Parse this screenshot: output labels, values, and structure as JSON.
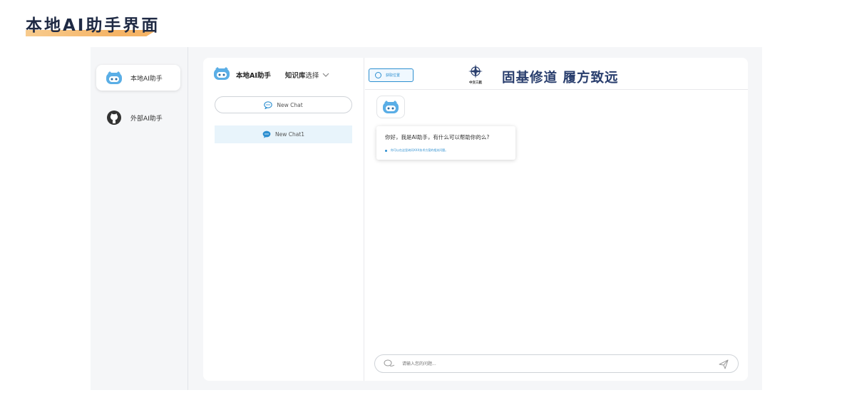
{
  "page": {
    "title": "本地AI助手界面"
  },
  "sidebar": {
    "items": [
      {
        "label": "本地AI助手",
        "icon": "bot-icon",
        "active": true
      },
      {
        "label": "外部AI助手",
        "icon": "github-icon",
        "active": false
      }
    ]
  },
  "chat_list": {
    "header_name": "本地AI助手",
    "kb_bold": "知识库",
    "kb_rest": "选择",
    "new_chat_label": "New Chat",
    "chats": [
      {
        "label": "New Chat1",
        "selected": true
      }
    ]
  },
  "main": {
    "location_button": "获取位置",
    "logo_text": "中交三航",
    "slogan": "固基修道  履方致远",
    "greeting": "你好，我是AI助手，有什么可以帮助你的么?",
    "suggestion": "你可以在这里询问XXX技术方案的相关问题。",
    "input_placeholder": "请输入您的问题..."
  },
  "colors": {
    "accent": "#2d8fd0",
    "title": "#1f2a44",
    "slogan": "#2a3f6e",
    "highlight": "#e8f4fb"
  }
}
